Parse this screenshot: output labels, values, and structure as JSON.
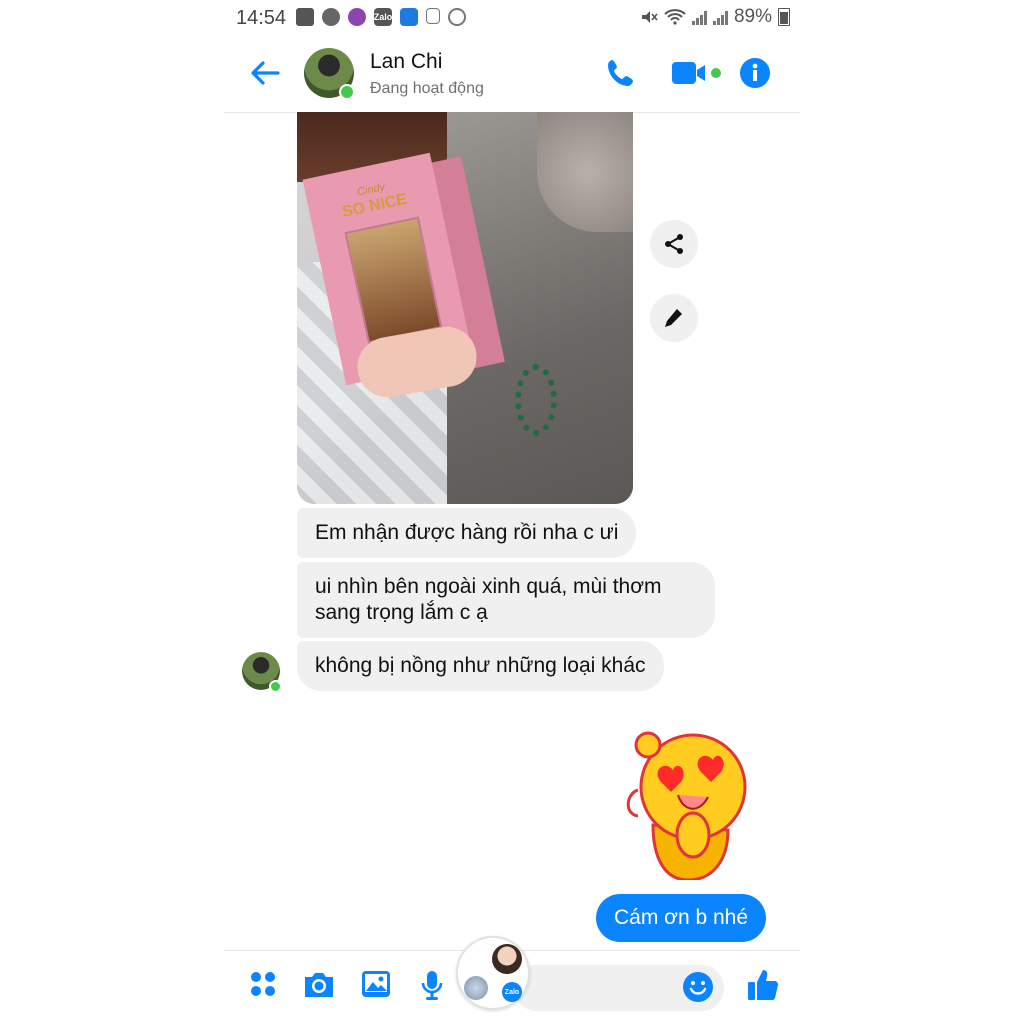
{
  "status_bar": {
    "time": "14:54",
    "battery": "89%",
    "zalo_label": "Zalo"
  },
  "header": {
    "contact_name": "Lan Chi",
    "status": "Đang hoạt động"
  },
  "photo": {
    "brand_script": "Cindy",
    "brand_name": "SO NICE"
  },
  "messages": [
    {
      "sender": "Lan Chi",
      "text": "Em nhận được hàng rồi nha c ưi"
    },
    {
      "sender": "Lan Chi",
      "text": "ui nhìn bên ngoài xinh quá, mùi thơm sang trọng lắm c ạ"
    },
    {
      "sender": "Lan Chi",
      "text": "không bị nồng như những loại khác"
    },
    {
      "sender": "me",
      "text": "Cám ơn b nhé"
    }
  ],
  "colors": {
    "accent": "#0a84ff",
    "online": "#44c94a",
    "bubble_gray": "#f0f0f0"
  }
}
